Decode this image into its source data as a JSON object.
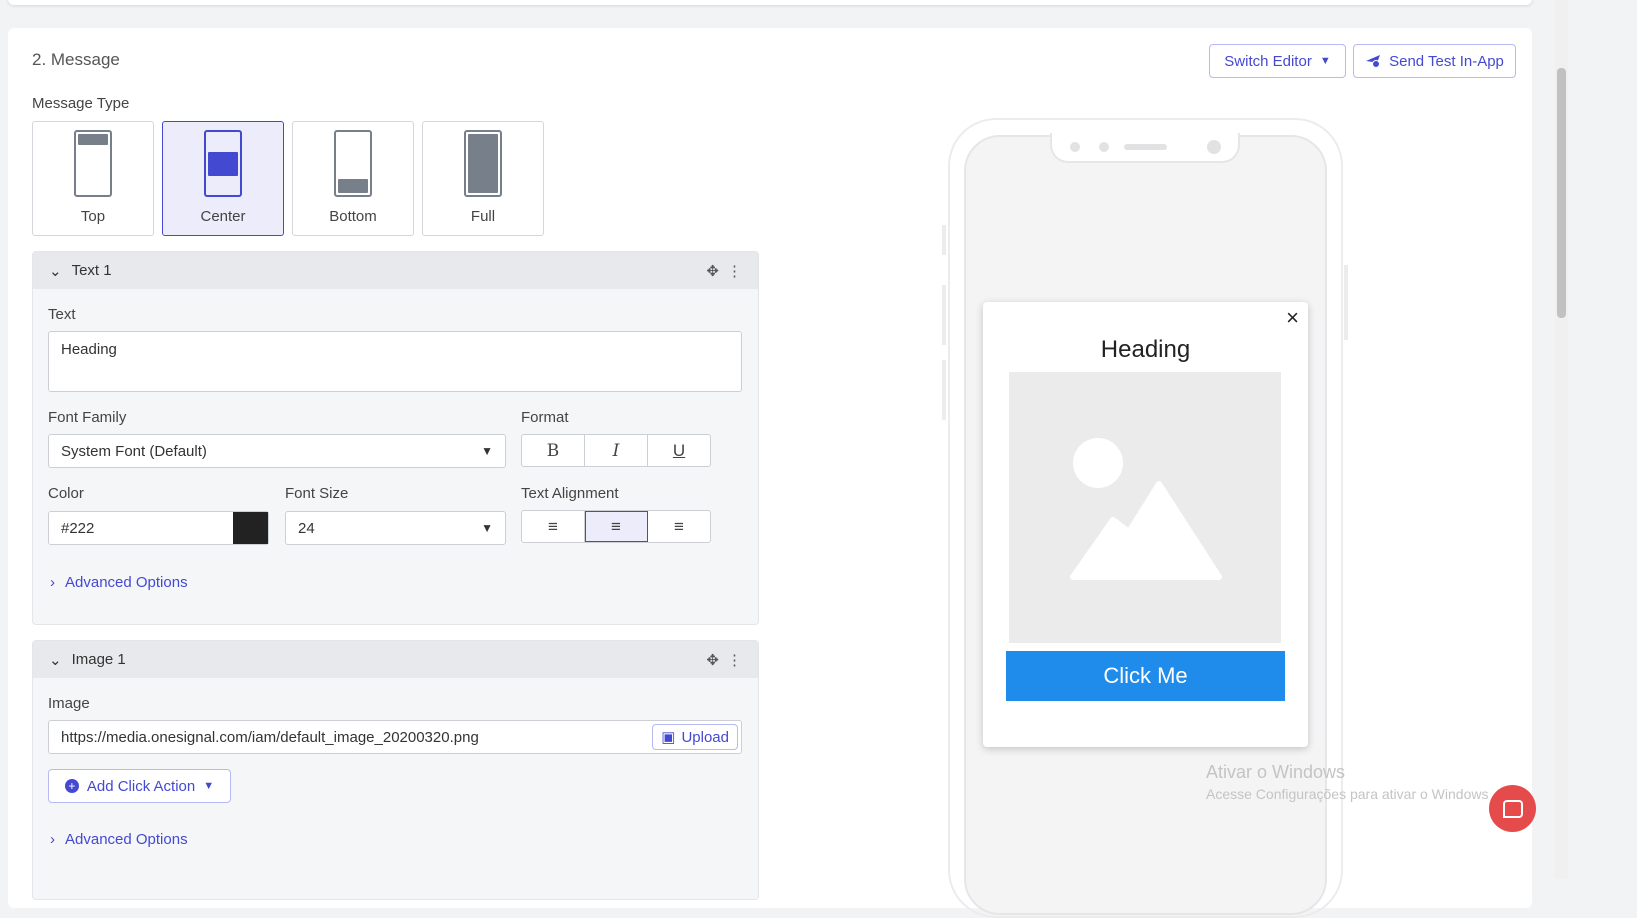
{
  "section_title": "2. Message",
  "header_buttons": {
    "switch_editor": "Switch Editor",
    "send_test": "Send Test In-App"
  },
  "message_type": {
    "label": "Message Type",
    "options": [
      "Top",
      "Center",
      "Bottom",
      "Full"
    ],
    "selected": "Center"
  },
  "text_block": {
    "title": "Text 1",
    "text_label": "Text",
    "text_value": "Heading",
    "font_family_label": "Font Family",
    "font_family_value": "System Font (Default)",
    "format_label": "Format",
    "format_buttons": [
      "B",
      "I",
      "U"
    ],
    "color_label": "Color",
    "color_value": "#222",
    "font_size_label": "Font Size",
    "font_size_value": "24",
    "alignment_label": "Text Alignment",
    "alignment_selected": "center",
    "advanced": "Advanced Options"
  },
  "image_block": {
    "title": "Image 1",
    "image_label": "Image",
    "image_url": "https://media.onesignal.com/iam/default_image_20200320.png",
    "upload": "Upload",
    "add_click_action": "Add Click Action",
    "advanced": "Advanced Options"
  },
  "preview": {
    "heading": "Heading",
    "button": "Click Me",
    "button_color": "#1f8ceb",
    "close": "×"
  },
  "watermark": {
    "title": "Ativar o Windows",
    "subtitle": "Acesse Configurações para ativar o Windows"
  },
  "accent": "#4449d2"
}
